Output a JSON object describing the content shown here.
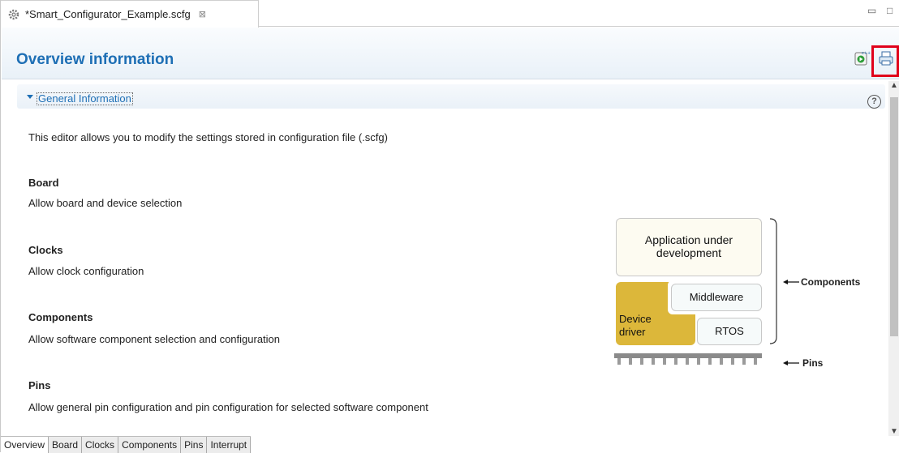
{
  "editor_tab": {
    "title": "*Smart_Configurator_Example.scfg",
    "close_glyph": "⊠",
    "icon": "gear-icon"
  },
  "window_controls": {
    "minimize": "▭",
    "maximize": "□"
  },
  "header": {
    "title": "Overview information",
    "generate_icon": "generate-code-icon",
    "report_icon": "generate-report-icon"
  },
  "section": {
    "label": "General Information",
    "help": "?"
  },
  "content": {
    "intro": "This editor allows you to modify the settings stored in configuration file (.scfg)",
    "items": [
      {
        "heading": "Board",
        "desc": "Allow board and device selection"
      },
      {
        "heading": "Clocks",
        "desc": "Allow clock configuration"
      },
      {
        "heading": "Components",
        "desc": "Allow software component selection and configuration"
      },
      {
        "heading": "Pins",
        "desc": "Allow general pin configuration and pin configuration for selected software component"
      }
    ]
  },
  "diagram": {
    "app_line1": "Application under",
    "app_line2": "development",
    "middleware": "Middleware",
    "driver_line1": "Device",
    "driver_line2": "driver",
    "rtos": "RTOS",
    "components_label": "Components",
    "pins_label": "Pins"
  },
  "bottom_tabs": [
    "Overview",
    "Board",
    "Clocks",
    "Components",
    "Pins",
    "Interrupt"
  ],
  "colors": {
    "title": "#1e6fb5",
    "driver": "#dcb73a",
    "highlight": "#e0001a"
  }
}
